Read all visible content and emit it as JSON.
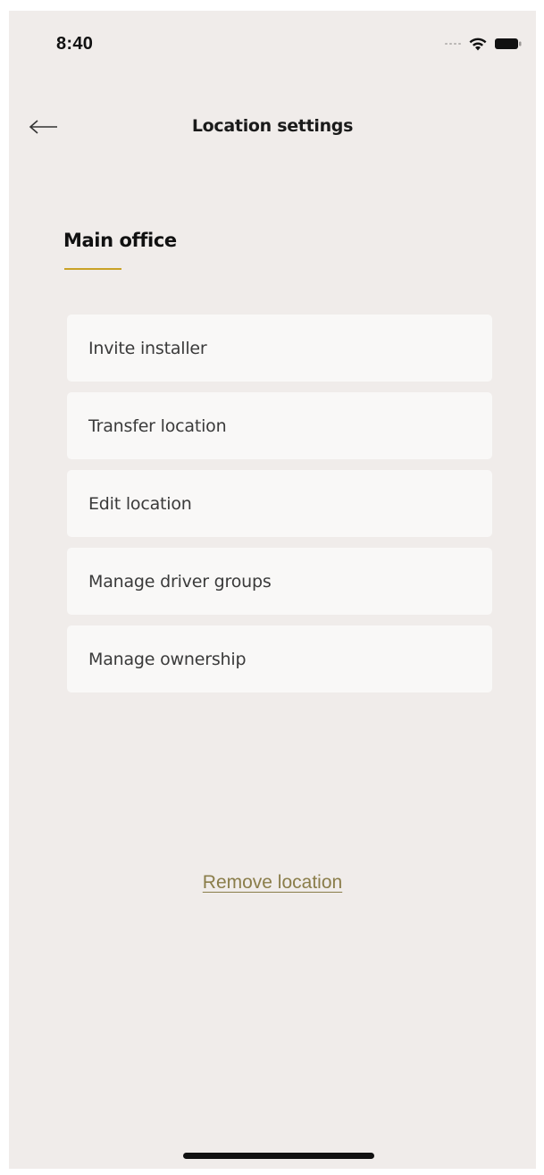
{
  "status_bar": {
    "time": "8:40",
    "icons": [
      "signal-dots-icon",
      "wifi-icon",
      "battery-icon"
    ]
  },
  "header": {
    "back_icon": "arrow-left-icon",
    "title": "Location settings"
  },
  "section": {
    "title": "Main office",
    "accent_color": "#c9a227"
  },
  "menu": {
    "items": [
      {
        "label": "Invite installer"
      },
      {
        "label": "Transfer location"
      },
      {
        "label": "Edit location"
      },
      {
        "label": "Manage driver groups"
      },
      {
        "label": "Manage ownership"
      }
    ]
  },
  "actions": {
    "remove_label": "Remove location",
    "remove_color": "#8a7d4a"
  },
  "theme": {
    "background": "#f0ecea",
    "card_background": "#f9f8f7",
    "text_primary": "#111111",
    "text_secondary": "#3a3a3a"
  }
}
